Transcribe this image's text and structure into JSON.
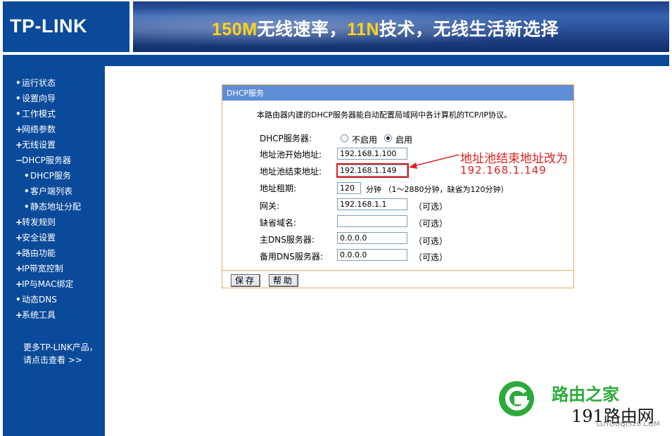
{
  "header": {
    "logo": "TP-LINK",
    "banner_part1": "150M",
    "banner_part2": "无线速率，",
    "banner_part3": "11N",
    "banner_part4": "技术，无线生活新选择"
  },
  "sidebar": {
    "items": [
      {
        "bullet": "•",
        "label": "运行状态"
      },
      {
        "bullet": "•",
        "label": "设置向导"
      },
      {
        "bullet": "•",
        "label": "工作模式"
      },
      {
        "bullet": "+",
        "label": "网络参数"
      },
      {
        "bullet": "+",
        "label": "无线设置"
      },
      {
        "bullet": "−",
        "label": "DHCP服务器"
      },
      {
        "bullet": "•",
        "label": "DHCP服务"
      },
      {
        "bullet": "•",
        "label": "客户端列表"
      },
      {
        "bullet": "•",
        "label": "静态地址分配"
      },
      {
        "bullet": "+",
        "label": "转发规则"
      },
      {
        "bullet": "+",
        "label": "安全设置"
      },
      {
        "bullet": "+",
        "label": "路由功能"
      },
      {
        "bullet": "+",
        "label": "IP带宽控制"
      },
      {
        "bullet": "+",
        "label": "IP与MAC绑定"
      },
      {
        "bullet": "•",
        "label": "动态DNS"
      },
      {
        "bullet": "+",
        "label": "系统工具"
      }
    ],
    "more_line1": "更多TP-LINK产品，",
    "more_line2": "请点击查看 >>"
  },
  "panel": {
    "title": "DHCP服务",
    "description": "本路由器内建的DHCP服务器能自动配置局域网中各计算机的TCP/IP协议。",
    "dhcp_label": "DHCP服务器:",
    "radio_off_label": "不启用",
    "radio_on_label": "启用",
    "radio_selected": "启用",
    "fields": {
      "start_label": "地址池开始地址:",
      "start_value": "192.168.1.100",
      "end_label": "地址池结束地址:",
      "end_value": "192.168.1.149",
      "lease_label": "地址租期:",
      "lease_value": "120",
      "lease_unit": "分钟 （1～2880分钟，缺省为120分钟）",
      "gateway_label": "网关:",
      "gateway_value": "192.168.1.1",
      "domain_label": "缺省域名:",
      "domain_value": "",
      "dns1_label": "主DNS服务器:",
      "dns1_value": "0.0.0.0",
      "dns2_label": "备用DNS服务器:",
      "dns2_value": "0.0.0.0",
      "optional": "（可选）"
    },
    "save_button": "保存",
    "help_button": "帮助"
  },
  "annotation": {
    "line1": "地址池结束地址改为",
    "line2": "192.168.1.149",
    "color": "#e02020"
  },
  "watermark": {
    "brand": "路由之家",
    "number": "191路由网",
    "url": "LUYOUQI520.COM"
  },
  "colors": {
    "nav_blue": "#0a4a9a",
    "panel_header": "#5d8ed6",
    "panel_border": "#f0a866",
    "banner_yellow": "#ffd21a"
  }
}
